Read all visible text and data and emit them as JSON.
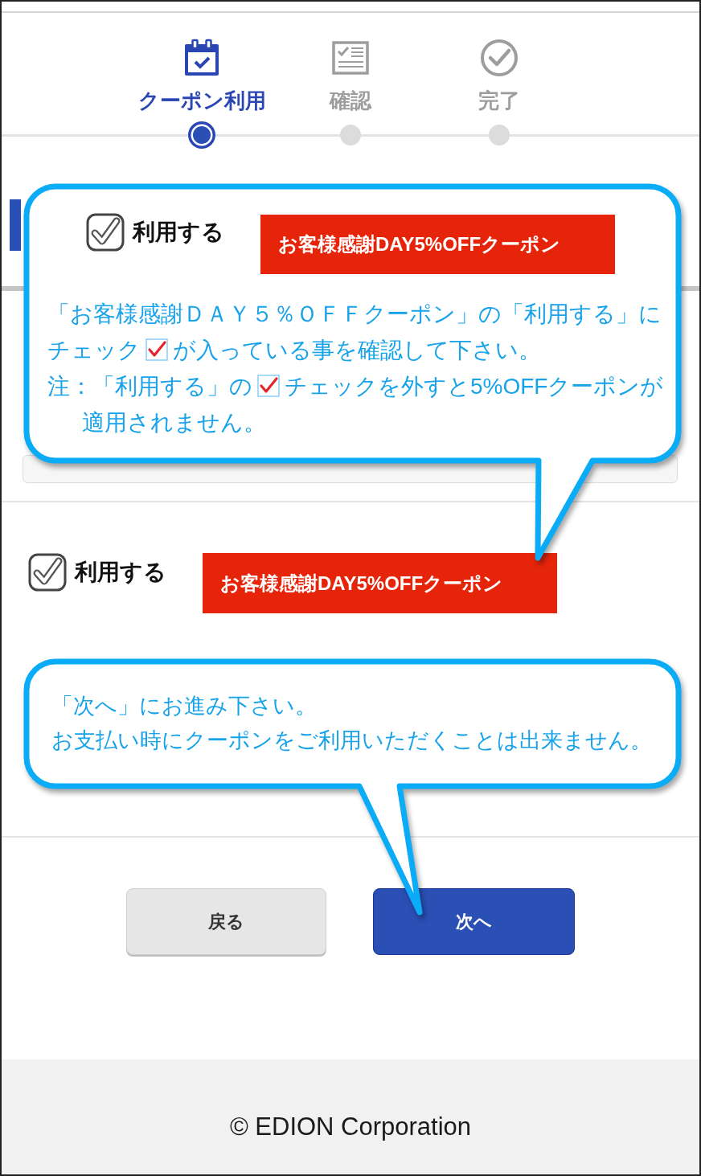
{
  "steps": [
    {
      "label": "クーポン利用",
      "selected": true
    },
    {
      "label": "確認",
      "selected": false
    },
    {
      "label": "完了",
      "selected": false
    }
  ],
  "callout_top": {
    "example_row": {
      "checked": true,
      "label": "利用する",
      "coupon": "お客様感謝DAY5%OFFクーポン"
    },
    "message_lines": [
      [
        {
          "kind": "text",
          "text": "「お客様感謝ＤＡＹ５％ＯＦＦクーポン」の「利用する」に"
        }
      ],
      [
        {
          "kind": "text",
          "text": "チェック"
        },
        {
          "kind": "check_icon"
        },
        {
          "kind": "text",
          "text": "が入っている事を確認して下さい。"
        }
      ]
    ],
    "note_lines": [
      [
        {
          "kind": "text",
          "text": "注：「利用する」の"
        },
        {
          "kind": "check_icon"
        },
        {
          "kind": "text",
          "text": "チェックを外すと5%OFFクーポンが"
        }
      ],
      [
        {
          "kind": "text",
          "text": "適用されません。"
        }
      ]
    ]
  },
  "coupon_row": {
    "checked": true,
    "label": "利用する",
    "coupon": "お客様感謝DAY5%OFFクーポン"
  },
  "callout_bottom": {
    "lines": [
      "「次へ」にお進み下さい。",
      "お支払い時にクーポンをご利用いただくことは出来ません。"
    ]
  },
  "buttons": [
    {
      "label": "戻る",
      "kind": "secondary"
    },
    {
      "label": "次へ",
      "kind": "primary"
    }
  ],
  "footer": {
    "copyright": "© EDION Corporation"
  }
}
